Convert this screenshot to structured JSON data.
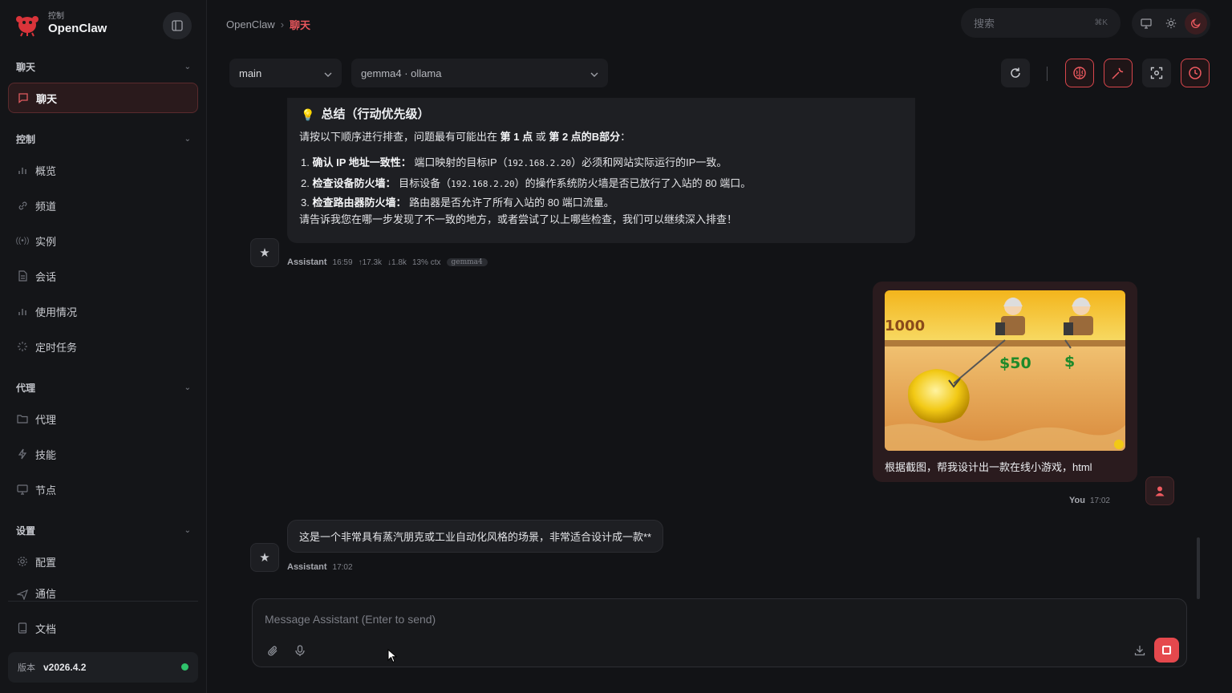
{
  "app": {
    "brand_sub": "控制",
    "brand_name": "OpenClaw"
  },
  "sidebar": {
    "sections": [
      {
        "title": "聊天",
        "items": [
          {
            "label": "聊天",
            "icon": "chat-icon",
            "active": true
          }
        ]
      },
      {
        "title": "控制",
        "items": [
          {
            "label": "概览",
            "icon": "bar-chart-icon"
          },
          {
            "label": "频道",
            "icon": "link-icon"
          },
          {
            "label": "实例",
            "icon": "broadcast-icon"
          },
          {
            "label": "会话",
            "icon": "document-icon"
          },
          {
            "label": "使用情况",
            "icon": "bar-chart-icon"
          },
          {
            "label": "定时任务",
            "icon": "loader-icon"
          }
        ]
      },
      {
        "title": "代理",
        "items": [
          {
            "label": "代理",
            "icon": "folder-icon"
          },
          {
            "label": "技能",
            "icon": "lightning-icon"
          },
          {
            "label": "节点",
            "icon": "monitor-icon"
          }
        ]
      },
      {
        "title": "设置",
        "items": [
          {
            "label": "配置",
            "icon": "gear-icon"
          },
          {
            "label": "通信",
            "icon": "send-icon"
          }
        ]
      }
    ],
    "docs_label": "文档",
    "version_label": "版本",
    "version_value": "v2026.4.2",
    "status_color": "#2fc26b"
  },
  "header": {
    "breadcrumb_root": "OpenClaw",
    "breadcrumb_sep": "›",
    "breadcrumb_current": "聊天",
    "search_placeholder": "搜索",
    "search_shortcut": "⌘K"
  },
  "toolbar": {
    "agent_select": "main",
    "model_select": "gemma4 · ollama"
  },
  "messages": {
    "summary": {
      "title": "总结（行动优先级）",
      "intro_pre": "请按以下顺序进行排查，问题最有可能出在 ",
      "intro_b1": "第 1 点",
      "intro_mid": " 或 ",
      "intro_b2": "第 2 点的B部分",
      "intro_post": "：",
      "items": [
        {
          "num": "1.",
          "bold": "确认 IP 地址一致性：",
          "pre": " 端口映射的目标IP（",
          "code": "192.168.2.20",
          "post": "）必须和网站实际运行的IP一致。"
        },
        {
          "num": "2.",
          "bold": "检查设备防火墙：",
          "pre": " 目标设备（",
          "code": "192.168.2.20",
          "post": "）的操作系统防火墙是否已放行了入站的 80 端口。"
        },
        {
          "num": "3.",
          "bold": "检查路由器防火墙：",
          "pre": " 路由器是否允许了所有入站的 80 端口流量。",
          "code": "",
          "post": ""
        }
      ],
      "closing": "请告诉我您在哪一步发现了不一致的地方，或者尝试了以上哪些检查，我们可以继续深入排查！",
      "meta": {
        "who": "Assistant",
        "time": "16:59",
        "tokens_in": "↑17.3k",
        "tokens_out": "↓1.8k",
        "ctx": "13% ctx",
        "model_tag": "gemma4"
      }
    },
    "user": {
      "caption": "根据截图，帮我设计出一款在线小游戏，html",
      "game_score": "1000",
      "game_price": "$50",
      "game_dollar": "$",
      "meta": {
        "who": "You",
        "time": "17:02"
      }
    },
    "reply": {
      "text": "这是一个非常具有蒸汽朋克或工业自动化风格的场景，非常适合设计成一款**",
      "meta": {
        "who": "Assistant",
        "time": "17:02"
      }
    }
  },
  "composer": {
    "placeholder": "Message Assistant (Enter to send)"
  },
  "colors": {
    "accent": "#e5484d",
    "sidebar_bg": "#141518",
    "main_bg": "#121316"
  }
}
